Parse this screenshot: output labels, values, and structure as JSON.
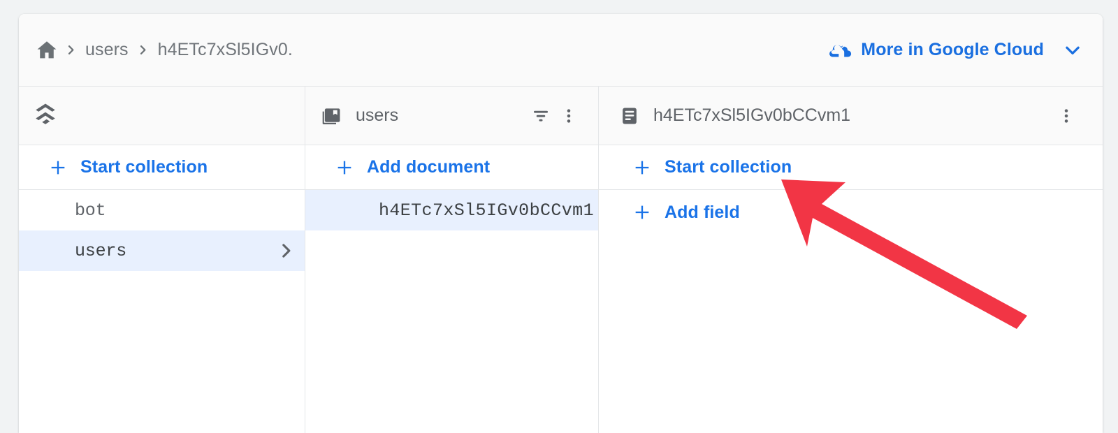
{
  "breadcrumb": {
    "home_icon": "home-icon",
    "separator_icon": "chevron-right-icon",
    "items": [
      "users",
      "h4ETc7xSl5IGv0."
    ]
  },
  "header_action": {
    "icon": "google-cloud-icon",
    "label": "More in Google Cloud",
    "chevron_icon": "chevron-down-icon",
    "color": "#1a6fe0"
  },
  "columns": {
    "root": {
      "header": {
        "logo_icon": "firestore-logo-icon"
      },
      "action": {
        "icon": "plus-icon",
        "label": "Start collection"
      },
      "items": [
        {
          "label": "bot",
          "selected": false,
          "has_chevron": false
        },
        {
          "label": "users",
          "selected": true,
          "has_chevron": true
        }
      ]
    },
    "collection": {
      "header": {
        "icon": "collections-bookmark-icon",
        "title": "users",
        "filter_icon": "filter-list-icon",
        "menu_icon": "more-vert-icon"
      },
      "action": {
        "icon": "plus-icon",
        "label": "Add document"
      },
      "items": [
        {
          "label": "h4ETc7xSl5IGv0bCCvm1",
          "selected": true
        }
      ]
    },
    "document": {
      "header": {
        "icon": "document-icon",
        "title": "h4ETc7xSl5IGv0bCCvm1",
        "menu_icon": "more-vert-icon"
      },
      "actions": [
        {
          "icon": "plus-icon",
          "label": "Start collection"
        },
        {
          "icon": "plus-icon",
          "label": "Add field"
        }
      ]
    }
  },
  "annotation": {
    "type": "arrow",
    "color": "#f23545",
    "points_to": "Start collection"
  },
  "theme": {
    "accent": "#1a73e8",
    "selected_row_bg": "#e8f0fe",
    "page_bg": "#f1f3f4",
    "header_bg": "#fafafa",
    "border": "#e4e6e8",
    "text_muted": "#5f6368"
  }
}
